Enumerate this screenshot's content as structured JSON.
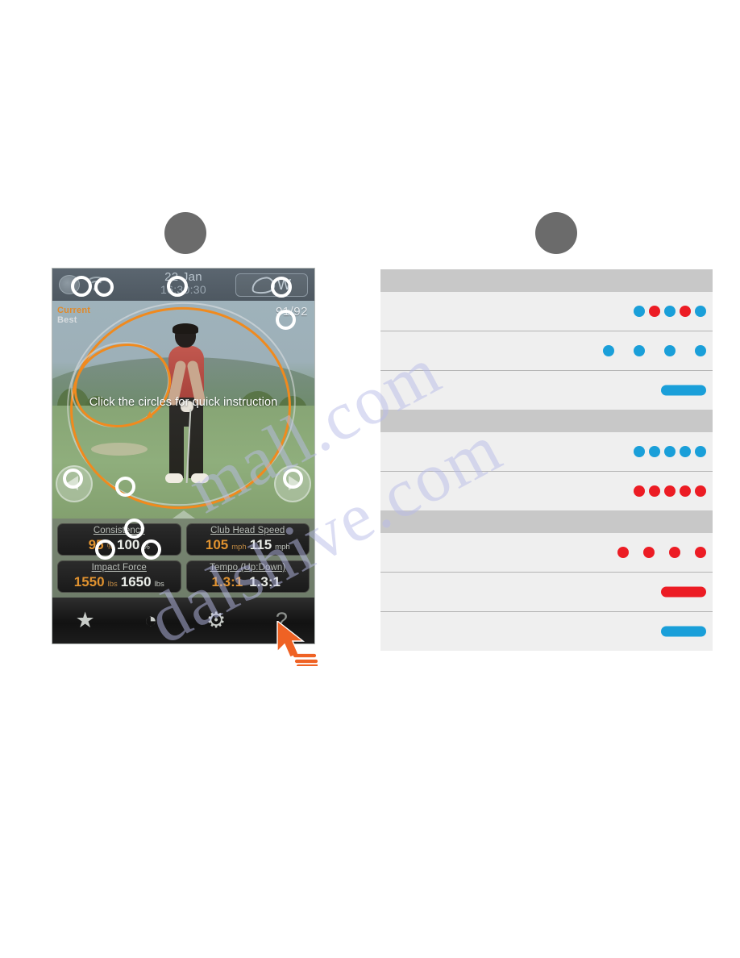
{
  "callouts": [
    {
      "name": "callout-left",
      "label": ""
    },
    {
      "name": "callout-right",
      "label": ""
    }
  ],
  "phone": {
    "status_bar": {
      "disc_icon": "disc-icon",
      "wifi_icon": "wifi-icon",
      "date": "22 Jan",
      "time": "16:30:30",
      "club_selector": {
        "icon": "club-head-icon",
        "label": "W"
      }
    },
    "swing_view": {
      "legend_current": "Current",
      "legend_best": "Best",
      "score": "91/92",
      "instruction": "Click the circles for quick instruction",
      "prev_icon": "play-left-icon",
      "next_icon": "play-right-icon",
      "scrub_handle_icon": "triangle-up-icon"
    },
    "stats": [
      {
        "title": "Consistency",
        "current_value": "95",
        "current_unit": "%",
        "best_value": "100",
        "best_unit": "%"
      },
      {
        "title": "Club Head Speed",
        "current_value": "105",
        "current_unit": "mph",
        "best_value": "115",
        "best_unit": "mph"
      },
      {
        "title": "Impact Force",
        "current_value": "1550",
        "current_unit": "lbs",
        "best_value": "1650",
        "best_unit": "lbs"
      },
      {
        "title": "Tempo (Up:Down)",
        "current_value": "1.3:1",
        "current_unit": "",
        "best_value": "1.3:1",
        "best_unit": ""
      }
    ],
    "toolbar": [
      {
        "icon": "star-icon",
        "glyph": "★"
      },
      {
        "icon": "clock-icon",
        "glyph": "◔"
      },
      {
        "icon": "gear-icon",
        "glyph": "⚙"
      },
      {
        "icon": "help-icon",
        "glyph": "?"
      }
    ],
    "cursor": "arrow-cursor-icon"
  },
  "colors": {
    "blue": "#1a9fd9",
    "red": "#ec1c24",
    "orange_trace": "#f08a1e",
    "current_text": "#e0922f",
    "best_text": "#e9ece7",
    "callout_gray": "#6b6b6b",
    "table_header_band": "#c8c8c8",
    "table_row": "#efefef"
  },
  "table": {
    "groups": [
      {
        "rows": [
          {
            "marker": "dots",
            "spacing": "tight",
            "items": [
              "blue",
              "red",
              "blue",
              "red",
              "blue"
            ]
          },
          {
            "marker": "dots",
            "spacing": "wide",
            "items": [
              "blue",
              "blue",
              "blue",
              "blue"
            ]
          },
          {
            "marker": "pill",
            "spacing": "tight",
            "items": [
              "blue"
            ]
          }
        ]
      },
      {
        "rows": [
          {
            "marker": "dots",
            "spacing": "tight",
            "items": [
              "blue",
              "blue",
              "blue",
              "blue",
              "blue"
            ]
          },
          {
            "marker": "dots",
            "spacing": "tight",
            "items": [
              "red",
              "red",
              "red",
              "red",
              "red"
            ]
          }
        ]
      },
      {
        "rows": [
          {
            "marker": "dots",
            "spacing": "med",
            "items": [
              "red",
              "red",
              "red",
              "red"
            ]
          },
          {
            "marker": "pill",
            "spacing": "tight",
            "items": [
              "red"
            ]
          },
          {
            "marker": "pill",
            "spacing": "tight",
            "items": [
              "blue"
            ]
          }
        ]
      }
    ]
  },
  "watermark": {
    "line1": "mall.com",
    "line2": "dalshive.com"
  }
}
